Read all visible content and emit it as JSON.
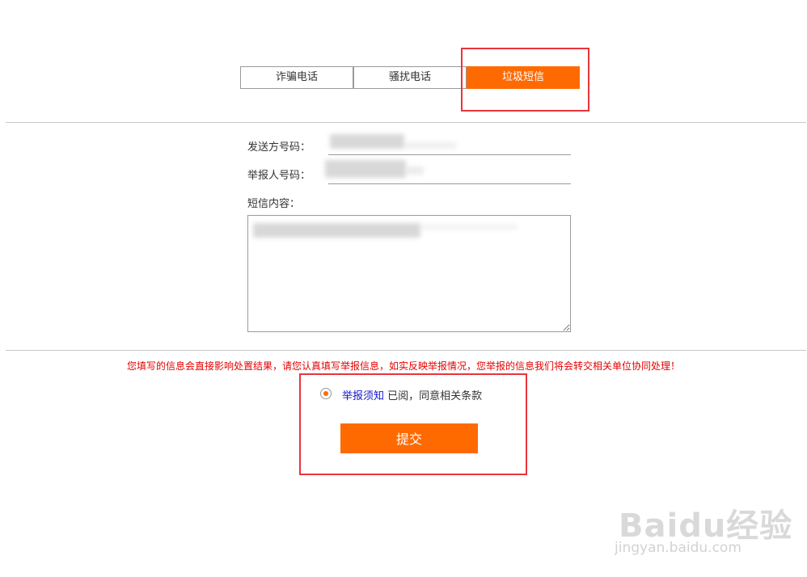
{
  "tabs": [
    {
      "label": "诈骗电话",
      "active": false
    },
    {
      "label": "骚扰电话",
      "active": false
    },
    {
      "label": "垃圾短信",
      "active": true
    }
  ],
  "form": {
    "sender_label": "发送方号码：",
    "reporter_label": "举报人号码：",
    "content_label": "短信内容："
  },
  "notice": "您填写的信息会直接影响处置结果，请您认真填写举报信息，如实反映举报情况，您举报的信息我们将会转交相关单位协同处理！",
  "agreement": {
    "link_text": "举报须知",
    "text": " 已阅，同意相关条款",
    "checked": true
  },
  "submit_label": "提交",
  "watermark": {
    "logo": "Baidu经验",
    "url": "jingyan.baidu.com"
  },
  "colors": {
    "accent": "#ff6a00",
    "highlight_box": "#e8353b",
    "notice": "#e60000",
    "link": "#1515d0"
  }
}
